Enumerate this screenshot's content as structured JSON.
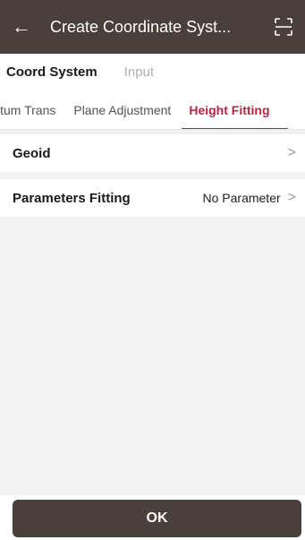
{
  "appbar": {
    "back_icon": "back-arrow-icon",
    "title": "Create Coordinate Syst...",
    "scan_icon": "scan-icon"
  },
  "top_tabs": [
    {
      "label": "Coord System",
      "active": true
    },
    {
      "label": "Input",
      "active": false
    }
  ],
  "sub_tabs": [
    {
      "label": "Datum Trans",
      "visible_label": "itum Trans",
      "active": false
    },
    {
      "label": "Plane Adjustment",
      "active": false
    },
    {
      "label": "Height Fitting",
      "active": true
    }
  ],
  "rows": {
    "geoid": {
      "label": "Geoid",
      "value": ""
    },
    "params": {
      "label": "Parameters Fitting",
      "value": "No Parameter"
    }
  },
  "footer": {
    "ok_label": "OK"
  },
  "colors": {
    "header_bg": "#4a3f3b",
    "accent": "#c3203e",
    "page_bg": "#f2f2f2"
  }
}
